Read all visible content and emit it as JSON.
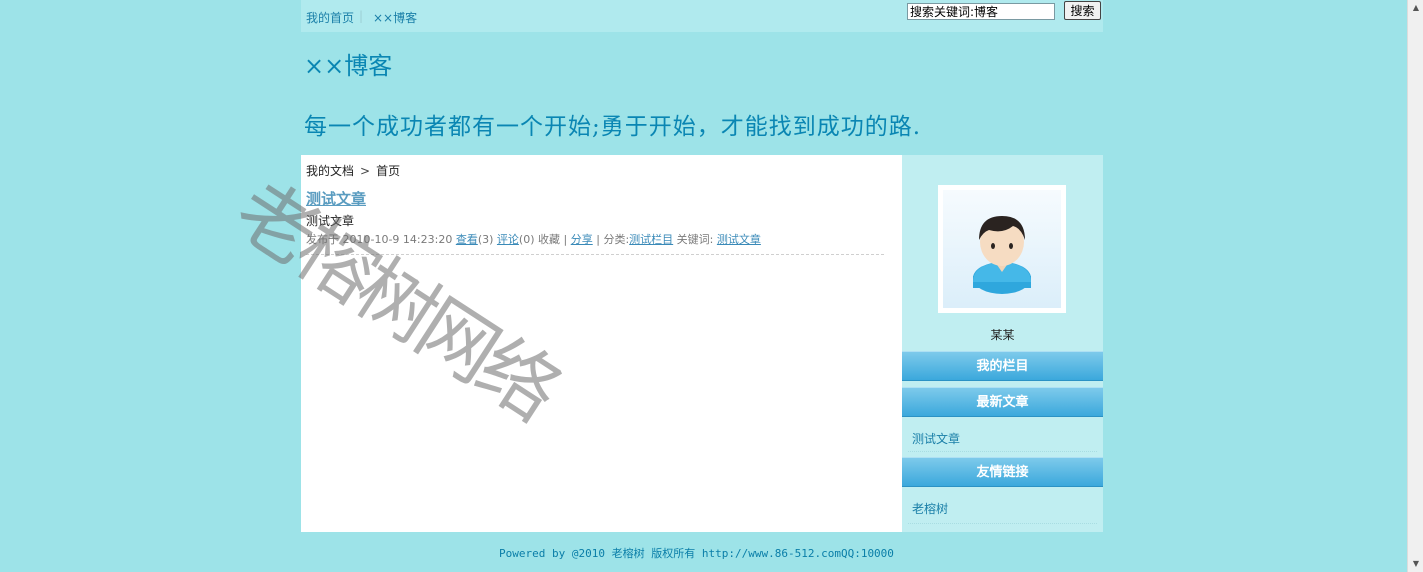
{
  "topbar": {
    "home_label": "我的首页",
    "separator": "|",
    "blog_label": "××博客",
    "search_value": "搜索关键词:博客",
    "search_button": "搜索"
  },
  "header": {
    "title": "××博客",
    "motto": "每一个成功者都有一个开始;勇于开始，才能找到成功的路."
  },
  "breadcrumb": {
    "root": "我的文档",
    "arrow": ">",
    "current": "首页"
  },
  "article": {
    "title": "测试文章",
    "summary": "测试文章",
    "meta": {
      "published_label": "发布于",
      "published_time": "2010-10-9 14:23:20",
      "view_label": "查看",
      "view_count": "(3)",
      "comment_label": "评论",
      "comment_count": "(0)",
      "favorite_label": "收藏",
      "sep": "|",
      "share_label": "分享",
      "category_label": "分类:",
      "category_value": "测试栏目",
      "keyword_label": "关键词:",
      "keyword_value": "测试文章"
    }
  },
  "sidebar": {
    "user_name": "某某",
    "sections": [
      {
        "title": "我的栏目"
      },
      {
        "title": "最新文章",
        "links": [
          "测试文章"
        ]
      },
      {
        "title": "友情链接",
        "links": [
          "老榕树"
        ]
      }
    ]
  },
  "footer": {
    "text": "Powered by @2010 老榕树 版权所有 http://www.86-512.comQQ:10000"
  },
  "watermark": "老榕树网络",
  "colors": {
    "page_bg": "#9de3e8",
    "topbar_bg": "#b0eaee",
    "accent": "#0a86b3",
    "side_head": "#3ba8dc"
  },
  "icons": {
    "avatar": "user-avatar-icon",
    "scroll_up": "arrow-up-icon",
    "scroll_down": "arrow-down-icon"
  }
}
